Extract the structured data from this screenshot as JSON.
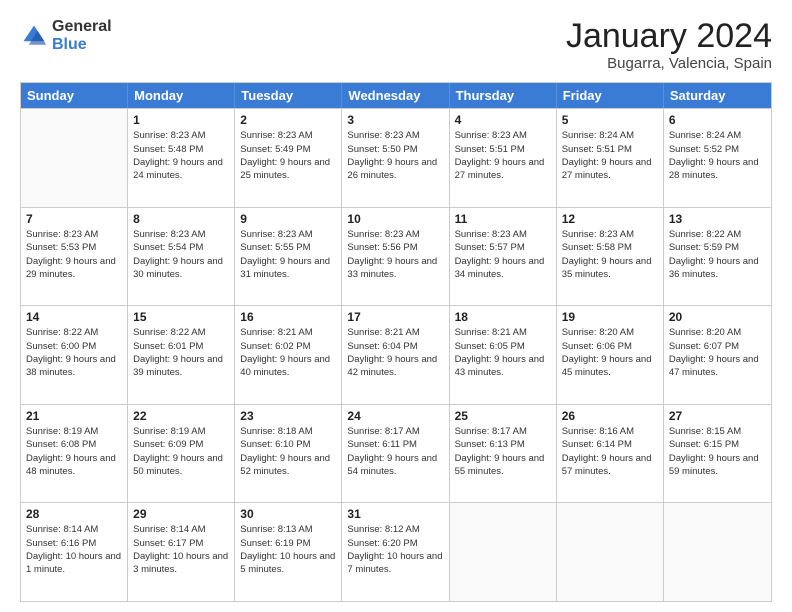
{
  "header": {
    "logo": {
      "general": "General",
      "blue": "Blue"
    },
    "title": "January 2024",
    "subtitle": "Bugarra, Valencia, Spain"
  },
  "calendar": {
    "weekdays": [
      "Sunday",
      "Monday",
      "Tuesday",
      "Wednesday",
      "Thursday",
      "Friday",
      "Saturday"
    ],
    "rows": [
      [
        {
          "day": "",
          "empty": true
        },
        {
          "day": "1",
          "sunrise": "Sunrise: 8:23 AM",
          "sunset": "Sunset: 5:48 PM",
          "daylight": "Daylight: 9 hours and 24 minutes."
        },
        {
          "day": "2",
          "sunrise": "Sunrise: 8:23 AM",
          "sunset": "Sunset: 5:49 PM",
          "daylight": "Daylight: 9 hours and 25 minutes."
        },
        {
          "day": "3",
          "sunrise": "Sunrise: 8:23 AM",
          "sunset": "Sunset: 5:50 PM",
          "daylight": "Daylight: 9 hours and 26 minutes."
        },
        {
          "day": "4",
          "sunrise": "Sunrise: 8:23 AM",
          "sunset": "Sunset: 5:51 PM",
          "daylight": "Daylight: 9 hours and 27 minutes."
        },
        {
          "day": "5",
          "sunrise": "Sunrise: 8:24 AM",
          "sunset": "Sunset: 5:51 PM",
          "daylight": "Daylight: 9 hours and 27 minutes."
        },
        {
          "day": "6",
          "sunrise": "Sunrise: 8:24 AM",
          "sunset": "Sunset: 5:52 PM",
          "daylight": "Daylight: 9 hours and 28 minutes."
        }
      ],
      [
        {
          "day": "7",
          "sunrise": "Sunrise: 8:23 AM",
          "sunset": "Sunset: 5:53 PM",
          "daylight": "Daylight: 9 hours and 29 minutes."
        },
        {
          "day": "8",
          "sunrise": "Sunrise: 8:23 AM",
          "sunset": "Sunset: 5:54 PM",
          "daylight": "Daylight: 9 hours and 30 minutes."
        },
        {
          "day": "9",
          "sunrise": "Sunrise: 8:23 AM",
          "sunset": "Sunset: 5:55 PM",
          "daylight": "Daylight: 9 hours and 31 minutes."
        },
        {
          "day": "10",
          "sunrise": "Sunrise: 8:23 AM",
          "sunset": "Sunset: 5:56 PM",
          "daylight": "Daylight: 9 hours and 33 minutes."
        },
        {
          "day": "11",
          "sunrise": "Sunrise: 8:23 AM",
          "sunset": "Sunset: 5:57 PM",
          "daylight": "Daylight: 9 hours and 34 minutes."
        },
        {
          "day": "12",
          "sunrise": "Sunrise: 8:23 AM",
          "sunset": "Sunset: 5:58 PM",
          "daylight": "Daylight: 9 hours and 35 minutes."
        },
        {
          "day": "13",
          "sunrise": "Sunrise: 8:22 AM",
          "sunset": "Sunset: 5:59 PM",
          "daylight": "Daylight: 9 hours and 36 minutes."
        }
      ],
      [
        {
          "day": "14",
          "sunrise": "Sunrise: 8:22 AM",
          "sunset": "Sunset: 6:00 PM",
          "daylight": "Daylight: 9 hours and 38 minutes."
        },
        {
          "day": "15",
          "sunrise": "Sunrise: 8:22 AM",
          "sunset": "Sunset: 6:01 PM",
          "daylight": "Daylight: 9 hours and 39 minutes."
        },
        {
          "day": "16",
          "sunrise": "Sunrise: 8:21 AM",
          "sunset": "Sunset: 6:02 PM",
          "daylight": "Daylight: 9 hours and 40 minutes."
        },
        {
          "day": "17",
          "sunrise": "Sunrise: 8:21 AM",
          "sunset": "Sunset: 6:04 PM",
          "daylight": "Daylight: 9 hours and 42 minutes."
        },
        {
          "day": "18",
          "sunrise": "Sunrise: 8:21 AM",
          "sunset": "Sunset: 6:05 PM",
          "daylight": "Daylight: 9 hours and 43 minutes."
        },
        {
          "day": "19",
          "sunrise": "Sunrise: 8:20 AM",
          "sunset": "Sunset: 6:06 PM",
          "daylight": "Daylight: 9 hours and 45 minutes."
        },
        {
          "day": "20",
          "sunrise": "Sunrise: 8:20 AM",
          "sunset": "Sunset: 6:07 PM",
          "daylight": "Daylight: 9 hours and 47 minutes."
        }
      ],
      [
        {
          "day": "21",
          "sunrise": "Sunrise: 8:19 AM",
          "sunset": "Sunset: 6:08 PM",
          "daylight": "Daylight: 9 hours and 48 minutes."
        },
        {
          "day": "22",
          "sunrise": "Sunrise: 8:19 AM",
          "sunset": "Sunset: 6:09 PM",
          "daylight": "Daylight: 9 hours and 50 minutes."
        },
        {
          "day": "23",
          "sunrise": "Sunrise: 8:18 AM",
          "sunset": "Sunset: 6:10 PM",
          "daylight": "Daylight: 9 hours and 52 minutes."
        },
        {
          "day": "24",
          "sunrise": "Sunrise: 8:17 AM",
          "sunset": "Sunset: 6:11 PM",
          "daylight": "Daylight: 9 hours and 54 minutes."
        },
        {
          "day": "25",
          "sunrise": "Sunrise: 8:17 AM",
          "sunset": "Sunset: 6:13 PM",
          "daylight": "Daylight: 9 hours and 55 minutes."
        },
        {
          "day": "26",
          "sunrise": "Sunrise: 8:16 AM",
          "sunset": "Sunset: 6:14 PM",
          "daylight": "Daylight: 9 hours and 57 minutes."
        },
        {
          "day": "27",
          "sunrise": "Sunrise: 8:15 AM",
          "sunset": "Sunset: 6:15 PM",
          "daylight": "Daylight: 9 hours and 59 minutes."
        }
      ],
      [
        {
          "day": "28",
          "sunrise": "Sunrise: 8:14 AM",
          "sunset": "Sunset: 6:16 PM",
          "daylight": "Daylight: 10 hours and 1 minute."
        },
        {
          "day": "29",
          "sunrise": "Sunrise: 8:14 AM",
          "sunset": "Sunset: 6:17 PM",
          "daylight": "Daylight: 10 hours and 3 minutes."
        },
        {
          "day": "30",
          "sunrise": "Sunrise: 8:13 AM",
          "sunset": "Sunset: 6:19 PM",
          "daylight": "Daylight: 10 hours and 5 minutes."
        },
        {
          "day": "31",
          "sunrise": "Sunrise: 8:12 AM",
          "sunset": "Sunset: 6:20 PM",
          "daylight": "Daylight: 10 hours and 7 minutes."
        },
        {
          "day": "",
          "empty": true
        },
        {
          "day": "",
          "empty": true
        },
        {
          "day": "",
          "empty": true
        }
      ]
    ]
  }
}
